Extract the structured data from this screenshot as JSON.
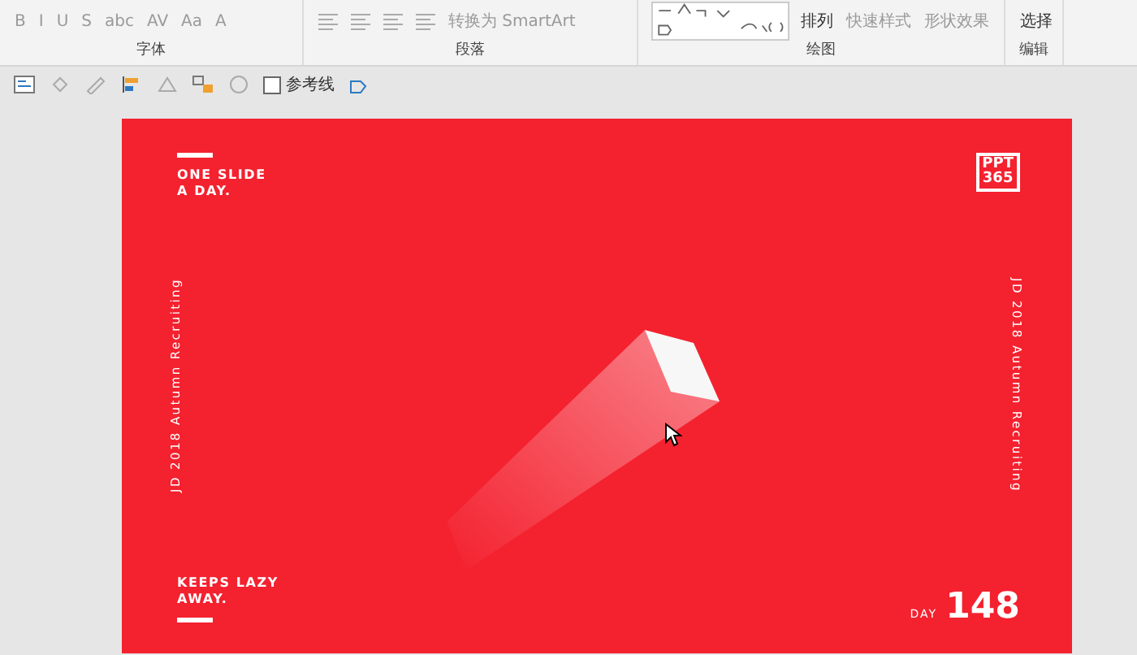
{
  "ribbon": {
    "groups": [
      {
        "label": "字体",
        "buttons": [
          {
            "text": "B",
            "disabled": true
          },
          {
            "text": "I",
            "disabled": true
          },
          {
            "text": "U",
            "disabled": true
          },
          {
            "text": "S",
            "disabled": true
          },
          {
            "text": "abc",
            "disabled": true
          },
          {
            "text": "AV",
            "disabled": true
          },
          {
            "text": "Aa",
            "disabled": true
          },
          {
            "text": "A",
            "disabled": true
          }
        ]
      },
      {
        "label": "段落",
        "buttons": [
          {
            "text": "转换为 SmartArt",
            "disabled": true
          }
        ]
      },
      {
        "label": "绘图",
        "buttons": [
          {
            "text": "排列",
            "disabled": false
          },
          {
            "text": "快速样式",
            "disabled": true
          },
          {
            "text": "形状效果",
            "disabled": true
          }
        ]
      },
      {
        "label": "编辑",
        "buttons": [
          {
            "text": "选择",
            "disabled": false
          }
        ]
      }
    ]
  },
  "quick_toolbar": {
    "guides": {
      "label": "参考线",
      "checked": false
    }
  },
  "slide": {
    "top_text": "ONE SLIDE\nA DAY.",
    "logo": "PPT\n365",
    "side_left": "JD 2018  Autumn  Recruiting",
    "side_right": "JD 2018  Autumn  Recruiting",
    "bottom_text": "KEEPS LAZY\nAWAY.",
    "day_label": "DAY",
    "day_number": "148"
  }
}
